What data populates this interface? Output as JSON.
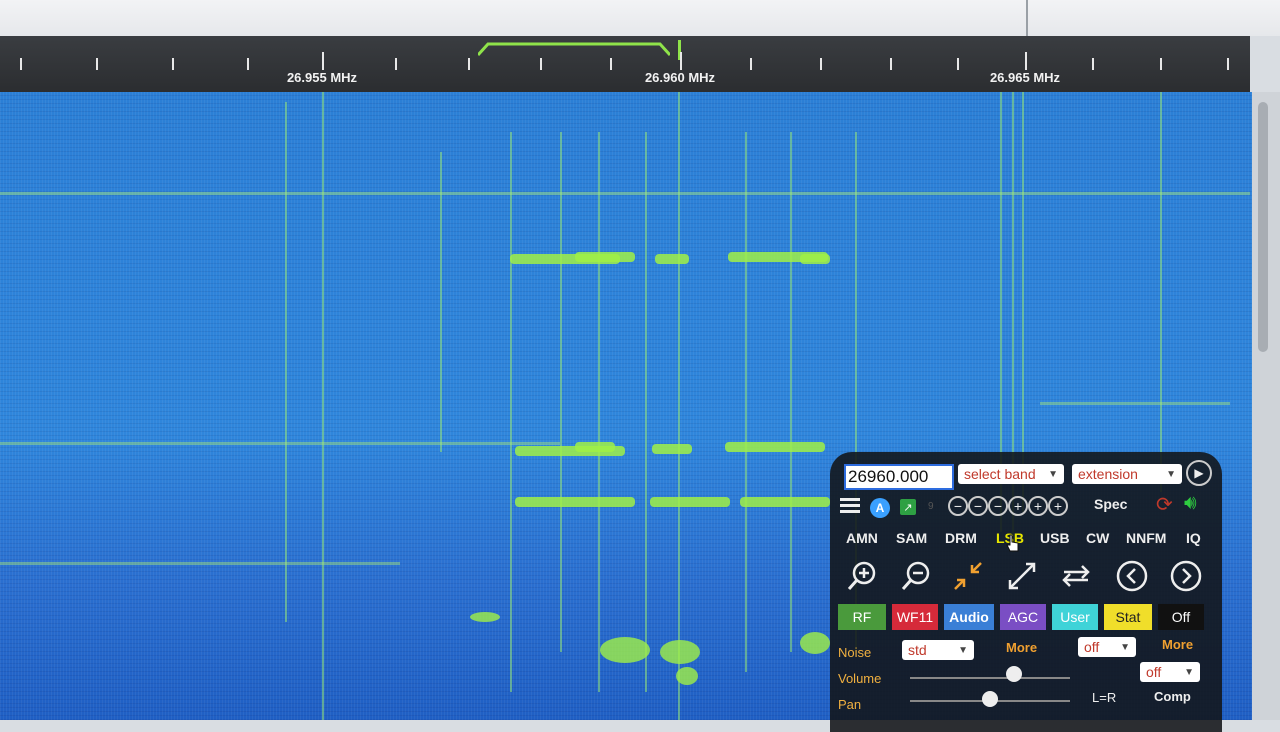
{
  "scale": {
    "labels": [
      "26.955 MHz",
      "26.960 MHz",
      "26.965 MHz"
    ]
  },
  "panel": {
    "frequency_value": "26960.000",
    "band_select": "select band",
    "extension_select": "extension",
    "auto_badge": "A",
    "small_number": "9",
    "spec_label": "Spec",
    "modes": [
      "AMN",
      "SAM",
      "DRM",
      "LSB",
      "USB",
      "CW",
      "NNFM",
      "IQ"
    ],
    "active_mode": "LSB",
    "tabs": [
      "RF",
      "WF11",
      "Audio",
      "AGC",
      "User",
      "Stat",
      "Off"
    ],
    "noise_label": "Noise",
    "noise_select": "std",
    "noise_more": "More",
    "noise_off_select": "off",
    "right_more": "More",
    "right_off_select": "off",
    "volume_label": "Volume",
    "pan_label": "Pan",
    "lr_label": "L=R",
    "comp_label": "Comp"
  },
  "colors": {
    "waterfall_base": "#2b7fd6",
    "signal_green": "#a0f046",
    "active_mode": "#e6e600",
    "frequency_border": "#2d6cdf"
  }
}
